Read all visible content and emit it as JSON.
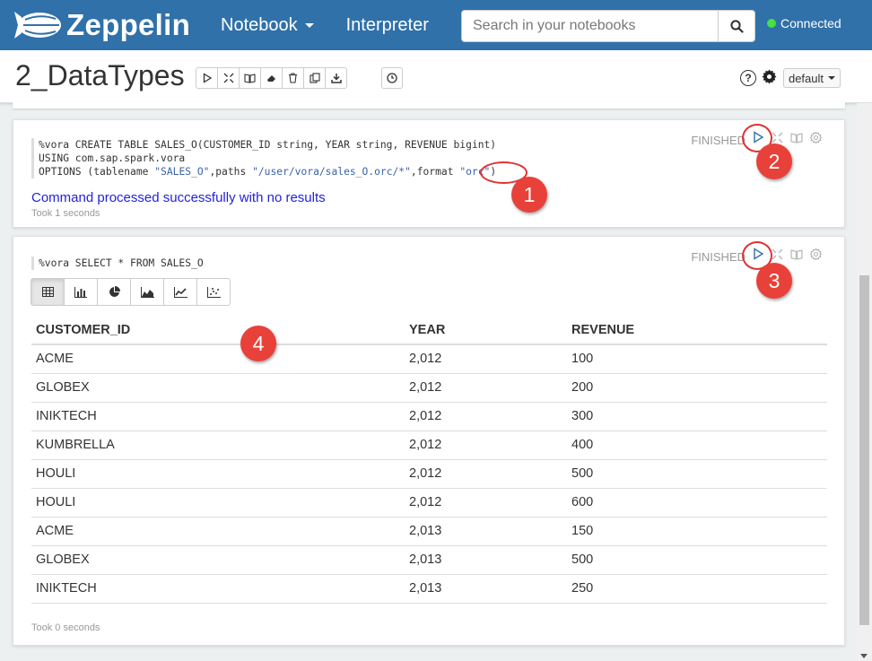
{
  "navbar": {
    "brand": "Zeppelin",
    "notebook_label": "Notebook",
    "interpreter_label": "Interpreter",
    "search_placeholder": "Search in your notebooks",
    "connection_status": "Connected",
    "connection_color": "#44e244",
    "bg_color": "#3071a9"
  },
  "header": {
    "title": "2_DataTypes",
    "toolbar_icons": [
      "play-icon",
      "collapse-icon",
      "book-icon",
      "eraser-icon",
      "trash-icon",
      "clone-icon",
      "download-icon"
    ],
    "schedule_icon": "clock-icon",
    "interpreter_binding": "default"
  },
  "paragraph1": {
    "code": {
      "line1": "%vora CREATE TABLE SALES_O(CUSTOMER_ID string, YEAR string, REVENUE bigint)",
      "line2": "USING com.sap.spark.vora",
      "line3_a": "OPTIONS (tablename ",
      "line3_b": "\"SALES_O\"",
      "line3_c": ",paths ",
      "line3_d": "\"/user/vora/sales_O.orc/*\"",
      "line3_e": ",format ",
      "line3_f": "\"orc\"",
      "line3_g": ")"
    },
    "status": "FINISHED",
    "result": "Command processed successfully with no results",
    "took": "Took 1 seconds"
  },
  "paragraph2": {
    "code": "%vora SELECT * FROM SALES_O",
    "status": "FINISHED",
    "chart_buttons": [
      "table-icon",
      "bar-chart-icon",
      "pie-chart-icon",
      "area-chart-icon",
      "line-chart-icon",
      "scatter-chart-icon"
    ],
    "columns": [
      "CUSTOMER_ID",
      "YEAR",
      "REVENUE"
    ],
    "rows": [
      [
        "ACME",
        "2,012",
        "100"
      ],
      [
        "GLOBEX",
        "2,012",
        "200"
      ],
      [
        "INIKTECH",
        "2,012",
        "300"
      ],
      [
        "KUMBRELLA",
        "2,012",
        "400"
      ],
      [
        "HOULI",
        "2,012",
        "500"
      ],
      [
        "HOULI",
        "2,012",
        "600"
      ],
      [
        "ACME",
        "2,013",
        "150"
      ],
      [
        "GLOBEX",
        "2,013",
        "500"
      ],
      [
        "INIKTECH",
        "2,013",
        "250"
      ]
    ],
    "took": "Took 0 seconds"
  },
  "annotations": {
    "badge1": "1",
    "badge2": "2",
    "badge3": "3",
    "badge4": "4",
    "color": "#e8413a"
  }
}
